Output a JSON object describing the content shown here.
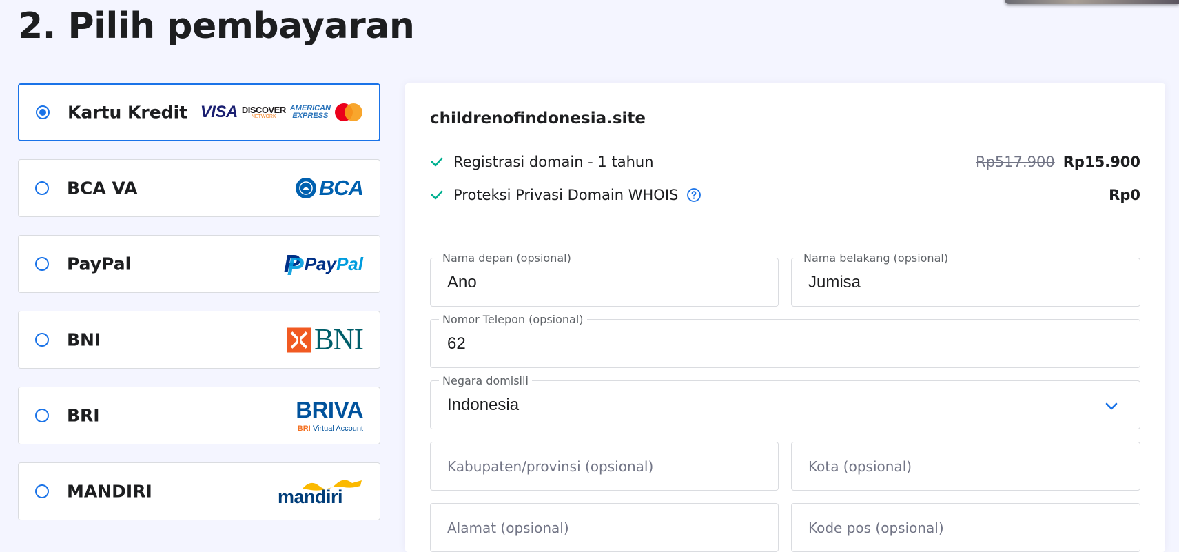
{
  "page": {
    "title": "2. Pilih pembayaran"
  },
  "payment_methods": [
    {
      "label": "Kartu Kredit",
      "selected": true
    },
    {
      "label": "BCA VA",
      "selected": false
    },
    {
      "label": "PayPal",
      "selected": false
    },
    {
      "label": "BNI",
      "selected": false
    },
    {
      "label": "BRI",
      "selected": false
    },
    {
      "label": "MANDIRI",
      "selected": false
    }
  ],
  "logos": {
    "visa": "VISA",
    "discover_top": "DISCOVER",
    "discover_bottom": "NETWORK",
    "amex_top": "AMERICAN",
    "amex_bottom": "EXPRESS",
    "bca": "BCA",
    "paypal_pay": "Pay",
    "paypal_pal": "Pal",
    "bni": "BNI",
    "briva_main": "BRIVA",
    "briva_bri": "BRI",
    "briva_sub": "Virtual Account",
    "mandiri": "mandiri"
  },
  "summary": {
    "domain": "childrenofindonesia.site",
    "items": [
      {
        "label": "Registrasi domain - 1 tahun",
        "old_price": "Rp517.900",
        "price": "Rp15.900"
      },
      {
        "label": "Proteksi Privasi Domain WHOIS",
        "price": "Rp0"
      }
    ]
  },
  "form": {
    "first_name": {
      "label": "Nama depan (opsional)",
      "value": "Ano"
    },
    "last_name": {
      "label": "Nama belakang (opsional)",
      "value": "Jumisa"
    },
    "phone": {
      "label": "Nomor Telepon (opsional)",
      "value": "62"
    },
    "country": {
      "label": "Negara domisili",
      "value": "Indonesia"
    },
    "province": {
      "placeholder": "Kabupaten/provinsi (opsional)"
    },
    "city": {
      "placeholder": "Kota (opsional)"
    },
    "address": {
      "placeholder": "Alamat (opsional)"
    },
    "postcode": {
      "placeholder": "Kode pos (opsional)"
    }
  },
  "colors": {
    "accent": "#1a73e8",
    "check": "#00b090",
    "background": "#f4f5ff",
    "text": "#1d1e20"
  },
  "icons": [
    "radio-icon",
    "check-icon",
    "help-icon",
    "chevron-down-icon"
  ]
}
